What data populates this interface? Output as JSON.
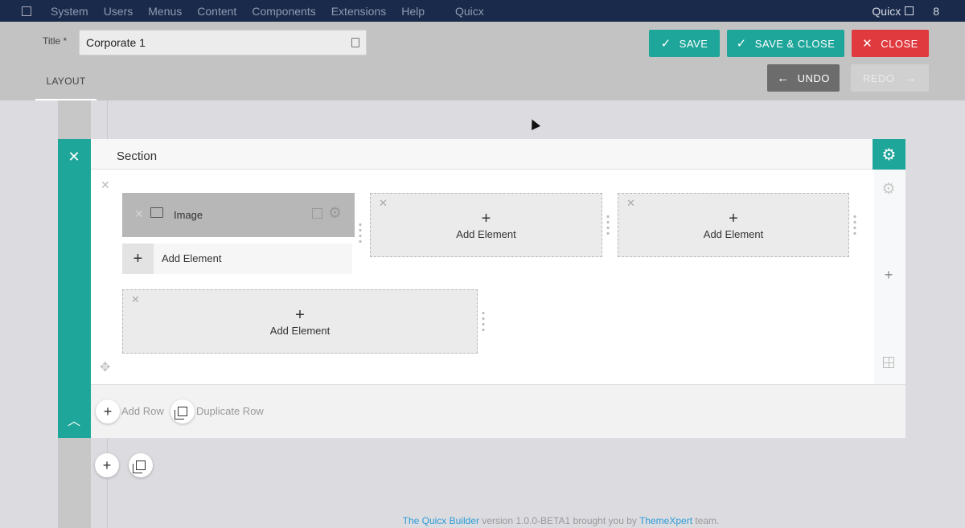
{
  "menubar": {
    "items": [
      "System",
      "Users",
      "Menus",
      "Content",
      "Components",
      "Extensions",
      "Help",
      "Quicx"
    ],
    "user_label": "Quicx",
    "count": "8"
  },
  "toolbar": {
    "title_label": "Title *",
    "title_value": "Corporate 1",
    "save_label": "SAVE",
    "save_close_label": "SAVE & CLOSE",
    "close_label": "CLOSE",
    "undo_label": "UNDO",
    "redo_label": "REDO",
    "tab_label": "LAYOUT"
  },
  "section": {
    "title": "Section",
    "image_element_label": "Image",
    "add_element_label": "Add Element",
    "add_row_label": "Add Row",
    "duplicate_row_label": "Duplicate Row"
  },
  "footer": {
    "link1": "The Quicx Builder",
    "middle": " version 1.0.0-BETA1 brought you by ",
    "link2": "ThemeXpert",
    "end": " team."
  },
  "colors": {
    "accent": "#1fa69a",
    "danger": "#e0393e",
    "menubar": "#1a2a4a"
  }
}
